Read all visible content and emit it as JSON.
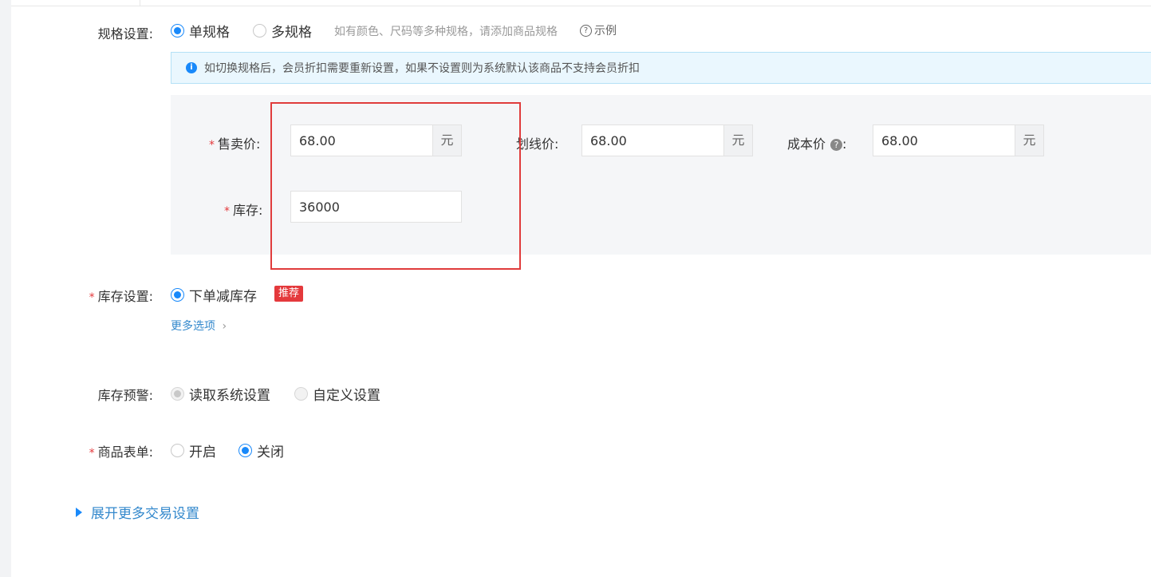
{
  "spec": {
    "label": "规格设置:",
    "single_label": "单规格",
    "multi_label": "多规格",
    "hint": "如有颜色、尺码等多种规格，请添加商品规格",
    "example_label": "示例"
  },
  "notice": {
    "text": "如切换规格后，会员折扣需要重新设置，如果不设置则为系统默认该商品不支持会员折扣"
  },
  "sku": {
    "price_label": "售卖价:",
    "price_value": "68.00",
    "strike_label": "划线价:",
    "strike_value": "68.00",
    "cost_label": "成本价",
    "cost_value": "68.00",
    "unit": "元",
    "stock_label": "库存:",
    "stock_value": "36000"
  },
  "inventory": {
    "label": "库存设置:",
    "option": "下单减库存",
    "badge": "推荐",
    "more": "更多选项"
  },
  "warning": {
    "label": "库存预警:",
    "system": "读取系统设置",
    "custom": "自定义设置"
  },
  "form": {
    "label": "商品表单:",
    "on": "开启",
    "off": "关闭"
  },
  "expand_more": "展开更多交易设置",
  "colors": {
    "accent": "#1989fa",
    "required": "#e4393c",
    "highlight_box": "#e03c3c",
    "link": "#3388cc"
  }
}
